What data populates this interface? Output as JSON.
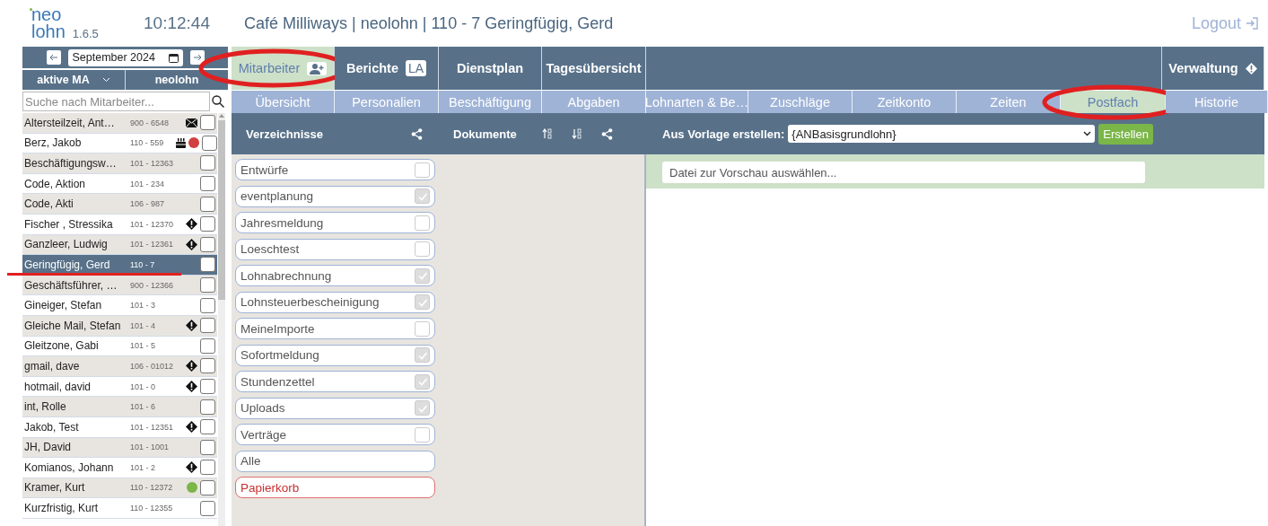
{
  "header": {
    "logo_top": "neo",
    "logo_bottom": "lohn",
    "version": "1.6.5",
    "time": "10:12:44",
    "title": "Café Milliways | neolohn | 110 - 7 Geringfügig, Gerd",
    "logout": "Logout"
  },
  "sidebar": {
    "month": "September 2024",
    "filter": "aktive MA",
    "client": "neolohn",
    "search_placeholder": "Suche nach Mitarbeiter...",
    "employees": [
      {
        "name": "Altersteilzeit, Ant…",
        "number": "900 - 6548",
        "selected": false,
        "checked": false,
        "mail": true,
        "birthday": false,
        "warning": false
      },
      {
        "name": "Berz, Jakob",
        "number": "110 - 559",
        "selected": false,
        "checked": false,
        "mail": false,
        "birthday": true,
        "warning": false,
        "color": "#d04040"
      },
      {
        "name": "Beschäftigungsw…",
        "number": "101 - 12363",
        "selected": false,
        "checked": false,
        "mail": false,
        "birthday": false,
        "warning": false
      },
      {
        "name": "Code, Aktion",
        "number": "101 - 234",
        "selected": false,
        "checked": false,
        "mail": false,
        "birthday": false,
        "warning": false
      },
      {
        "name": "Code, Akti",
        "number": "106 - 987",
        "selected": false,
        "checked": false,
        "mail": false,
        "birthday": false,
        "warning": false
      },
      {
        "name": "Fischer , Stressika",
        "number": "101 - 12370",
        "selected": false,
        "checked": false,
        "mail": false,
        "birthday": false,
        "warning": true
      },
      {
        "name": "Ganzleer, Ludwig",
        "number": "101 - 12361",
        "selected": false,
        "checked": false,
        "mail": false,
        "birthday": false,
        "warning": true
      },
      {
        "name": "Geringfügig, Gerd",
        "number": "110 - 7",
        "selected": true,
        "checked": false,
        "mail": false,
        "birthday": false,
        "warning": false,
        "underlined": true
      },
      {
        "name": "Geschäftsführer, …",
        "number": "900 - 12366",
        "selected": false,
        "checked": false,
        "mail": false,
        "birthday": false,
        "warning": false
      },
      {
        "name": "Gineiger, Stefan",
        "number": "101 - 3",
        "selected": false,
        "checked": false,
        "mail": false,
        "birthday": false,
        "warning": false
      },
      {
        "name": "Gleiche Mail, Stefan",
        "number": "101 - 4",
        "selected": false,
        "checked": false,
        "mail": false,
        "birthday": false,
        "warning": true
      },
      {
        "name": "Gleitzone, Gabi",
        "number": "101 - 5",
        "selected": false,
        "checked": false,
        "mail": false,
        "birthday": false,
        "warning": false
      },
      {
        "name": "gmail, dave",
        "number": "106 - 01012",
        "selected": false,
        "checked": false,
        "mail": false,
        "birthday": false,
        "warning": true
      },
      {
        "name": "hotmail, david",
        "number": "101 - 0",
        "selected": false,
        "checked": false,
        "mail": false,
        "birthday": false,
        "warning": true
      },
      {
        "name": "int, Rolle",
        "number": "101 - 6",
        "selected": false,
        "checked": false,
        "mail": false,
        "birthday": false,
        "warning": false
      },
      {
        "name": "Jakob, Test",
        "number": "101 - 12351",
        "selected": false,
        "checked": false,
        "mail": false,
        "birthday": false,
        "warning": true
      },
      {
        "name": "JH, David",
        "number": "101 - 1001",
        "selected": false,
        "checked": false,
        "mail": false,
        "birthday": false,
        "warning": false
      },
      {
        "name": "Komianos, Johann",
        "number": "101 - 2",
        "selected": false,
        "checked": false,
        "mail": false,
        "birthday": false,
        "warning": true
      },
      {
        "name": "Kramer, Kurt",
        "number": "110 - 12372",
        "selected": false,
        "checked": false,
        "mail": false,
        "birthday": false,
        "warning": false,
        "color": "#7ab648"
      },
      {
        "name": "Kurzfristig, Kurt",
        "number": "110 - 12355",
        "selected": false,
        "checked": false,
        "mail": false,
        "birthday": false,
        "warning": false
      }
    ]
  },
  "nav": {
    "tabs": [
      {
        "label": "Mitarbeiter",
        "kind": "person",
        "selected": true,
        "circled": true
      },
      {
        "label": "Berichte",
        "kind": "badge",
        "badge": "LA",
        "selected": false,
        "circled": false
      },
      {
        "label": "Dienstplan",
        "kind": "plain",
        "selected": false,
        "circled": false
      },
      {
        "label": "Tagesübersicht",
        "kind": "plain",
        "selected": false,
        "circled": false
      }
    ],
    "admin": "Verwaltung",
    "subtabs": [
      {
        "label": "Übersicht",
        "selected": false,
        "circled": false
      },
      {
        "label": "Personalien",
        "selected": false,
        "circled": false
      },
      {
        "label": "Beschäftigung",
        "selected": false,
        "circled": false
      },
      {
        "label": "Abgaben",
        "selected": false,
        "circled": false
      },
      {
        "label": "Lohnarten & Be…",
        "selected": false,
        "circled": false
      },
      {
        "label": "Zuschläge",
        "selected": false,
        "circled": false
      },
      {
        "label": "Zeitkonto",
        "selected": false,
        "circled": false
      },
      {
        "label": "Zeiten",
        "selected": false,
        "circled": false
      },
      {
        "label": "Postfach",
        "selected": true,
        "circled": true
      },
      {
        "label": "Historie",
        "selected": false,
        "circled": false
      }
    ]
  },
  "toolbar": {
    "folders_title": "Verzeichnisse",
    "documents_title": "Dokumente",
    "template_label": "Aus Vorlage erstellen:",
    "template_value": "{ANBasisgrundlohn}",
    "create": "Erstellen"
  },
  "folders": [
    {
      "label": "Entwürfe",
      "kind": "folder",
      "checked": false
    },
    {
      "label": "eventplanung",
      "kind": "folder",
      "checked": true
    },
    {
      "label": "Jahresmeldung",
      "kind": "folder",
      "checked": false
    },
    {
      "label": "Loeschtest",
      "kind": "folder",
      "checked": false
    },
    {
      "label": "Lohnabrechnung",
      "kind": "folder",
      "checked": true
    },
    {
      "label": "Lohnsteuerbescheinigung",
      "kind": "folder",
      "checked": true
    },
    {
      "label": "MeineImporte",
      "kind": "folder",
      "checked": false
    },
    {
      "label": "Sofortmeldung",
      "kind": "folder",
      "checked": true
    },
    {
      "label": "Stundenzettel",
      "kind": "folder",
      "checked": true
    },
    {
      "label": "Uploads",
      "kind": "folder",
      "checked": true
    },
    {
      "label": "Verträge",
      "kind": "folder",
      "checked": false
    },
    {
      "label": "Alle",
      "kind": "all"
    },
    {
      "label": "Papierkorb",
      "kind": "trash"
    }
  ],
  "preview": {
    "placeholder": "Datei zur Vorschau auswählen..."
  }
}
